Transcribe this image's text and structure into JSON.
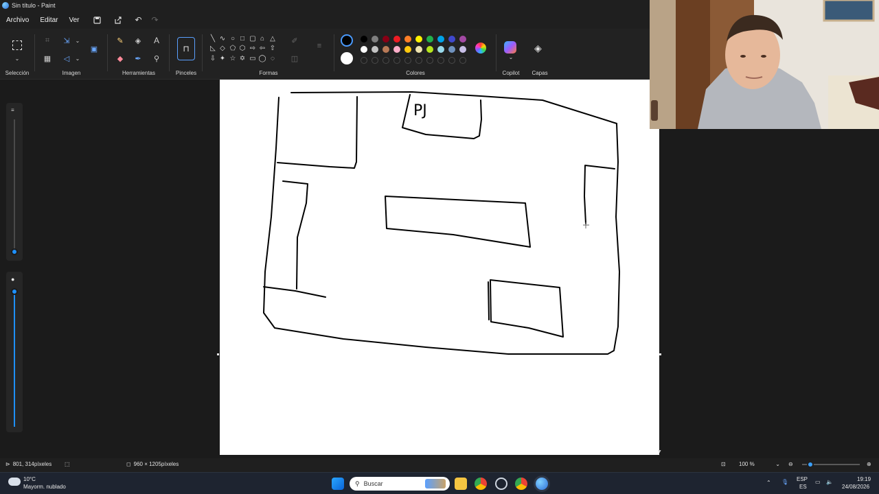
{
  "window": {
    "title": "Sin título - Paint"
  },
  "menu": {
    "items": [
      "Archivo",
      "Editar",
      "Ver"
    ]
  },
  "ribbon": {
    "groups": {
      "seleccion": "Selección",
      "imagen": "Imagen",
      "herramientas": "Herramientas",
      "pinceles": "Pinceles",
      "formas": "Formas",
      "colores": "Colores",
      "copilot": "Copilot",
      "capas": "Capas"
    },
    "current_color": "#000000",
    "secondary_color": "#ffffff",
    "palette_row1": [
      "#000000",
      "#7f7f7f",
      "#880015",
      "#ed1c24",
      "#ff7f27",
      "#fff200",
      "#22b14c",
      "#00a2e8",
      "#3f48cc",
      "#a349a4"
    ],
    "palette_row2": [
      "#ffffff",
      "#c3c3c3",
      "#b97a57",
      "#ffaec9",
      "#ffc90e",
      "#efe4b0",
      "#b5e61d",
      "#99d9ea",
      "#7092be",
      "#c8bfe7"
    ],
    "palette_row3_empty_count": 10
  },
  "canvas": {
    "drawn_text": "PJ"
  },
  "status": {
    "cursor_position": "801, 314píxeles",
    "canvas_size": "960 × 1205píxeles",
    "zoom": "100 %"
  },
  "taskbar": {
    "weather_temp": "10°C",
    "weather_desc": "Mayorm. nublado",
    "search_placeholder": "Buscar",
    "lang_top": "ESP",
    "lang_bottom": "ES",
    "time": "19:19",
    "date": "24/08/2026"
  }
}
